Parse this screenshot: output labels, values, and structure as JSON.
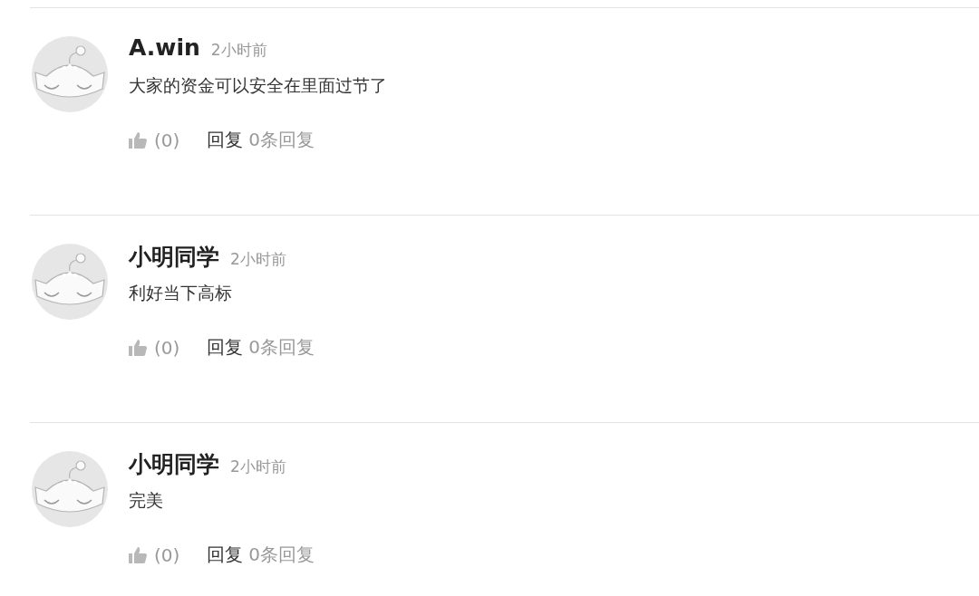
{
  "comments": [
    {
      "author": "A.win",
      "time": "2小时前",
      "text": "大家的资金可以安全在里面过节了",
      "likes": "(0)",
      "reply": "回复",
      "reply_count": "0条回复"
    },
    {
      "author": "小明同学",
      "time": "2小时前",
      "text": "利好当下高标",
      "likes": "(0)",
      "reply": "回复",
      "reply_count": "0条回复"
    },
    {
      "author": "小明同学",
      "time": "2小时前",
      "text": "完美",
      "likes": "(0)",
      "reply": "回复",
      "reply_count": "0条回复"
    }
  ]
}
